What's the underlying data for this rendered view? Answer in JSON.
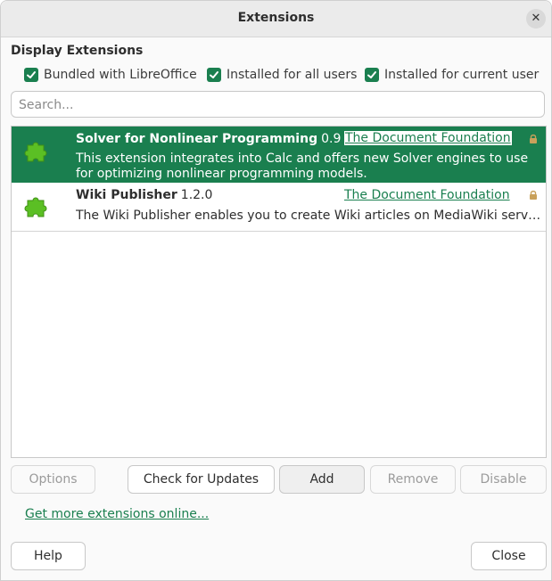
{
  "window": {
    "title": "Extensions",
    "close_glyph": "✕"
  },
  "filters": {
    "section_label": "Display Extensions",
    "bundled": {
      "label": "Bundled with LibreOffice",
      "checked": true
    },
    "all_users": {
      "label": "Installed for all users",
      "checked": true
    },
    "current_user": {
      "label": "Installed for current user",
      "checked": true
    }
  },
  "search": {
    "placeholder": "Search...",
    "value": ""
  },
  "extensions": [
    {
      "name": "Solver for Nonlinear Programming",
      "version": "0.9",
      "publisher": "The Document Foundation",
      "description": "This extension integrates into Calc and offers new Solver engines to use for optimizing nonlinear programming models.",
      "selected": true,
      "icon": "puzzle-piece-icon",
      "locked_icon": "lock-icon"
    },
    {
      "name": "Wiki Publisher",
      "version": "1.2.0",
      "publisher": "The Document Foundation",
      "description": "The Wiki Publisher enables you to create Wiki articles on MediaWiki servers without having to know the syntax of the MediaWiki markup language.",
      "selected": false,
      "icon": "puzzle-piece-icon",
      "locked_icon": "lock-icon"
    }
  ],
  "actions": {
    "options": "Options",
    "check_updates": "Check for Updates",
    "add": "Add",
    "remove": "Remove",
    "disable": "Disable"
  },
  "get_more_link": "Get more extensions online...",
  "footer": {
    "help": "Help",
    "close": "Close"
  },
  "colors": {
    "accent": "#1a7f4f",
    "puzzle_green": "#5bbf24",
    "lock": "#c9a15b"
  }
}
